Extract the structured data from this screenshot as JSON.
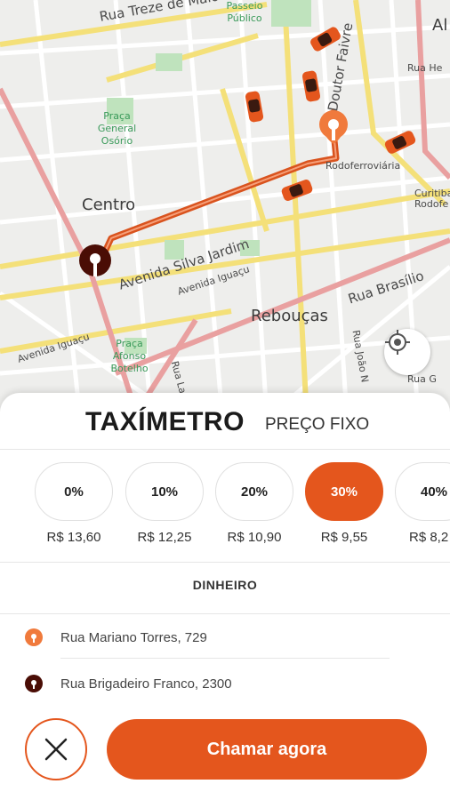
{
  "map": {
    "labels": {
      "street_treze_de_maio": "Rua Treze de Maio",
      "passeio_publico": "Passeio Público",
      "praca_general_osorio": "Praça General Osório",
      "doutor_faivre": "Doutor Faivre",
      "rodoferroviaria": "Rodoferroviária",
      "curitiba_rodofe": "Curitiba Rodofe",
      "centro": "Centro",
      "avenida_silva_jardim": "Avenida Silva Jardim",
      "avenida_iguacu_1": "Avenida Iguaçu",
      "avenida_iguacu_2": "Avenida Iguaçu",
      "reboucas": "Rebouças",
      "rua_brasilio": "Rua Brasílio",
      "rua_joao": "Rua João N",
      "praca_afonso_botelho": "Praça Afonso Botelho",
      "rua_la": "Rua La",
      "rua_he": "Rua He",
      "rua_g": "Rua G",
      "al": "Al"
    },
    "route_color": "#d9531e",
    "taxi_color": "#e4561d",
    "origin_pin_color": "#f07a3c",
    "destination_pin_color": "#4a0d05",
    "locate_icon": "crosshair-icon"
  },
  "sheet": {
    "tab_active": "TAXÍMETRO",
    "tab_inactive": "PREÇO FIXO",
    "discounts": [
      {
        "label": "0%",
        "price": "R$ 13,60",
        "active": false
      },
      {
        "label": "10%",
        "price": "R$ 12,25",
        "active": false
      },
      {
        "label": "20%",
        "price": "R$ 10,90",
        "active": false
      },
      {
        "label": "30%",
        "price": "R$ 9,55",
        "active": true
      },
      {
        "label": "40%",
        "price": "R$ 8,2",
        "active": false
      }
    ],
    "payment_method": "DINHEIRO",
    "origin_address": "Rua Mariano Torres, 729",
    "destination_address": "Rua Brigadeiro Franco, 2300",
    "call_button": "Chamar agora",
    "cancel_icon": "close-icon",
    "accent_color": "#e4561d"
  }
}
